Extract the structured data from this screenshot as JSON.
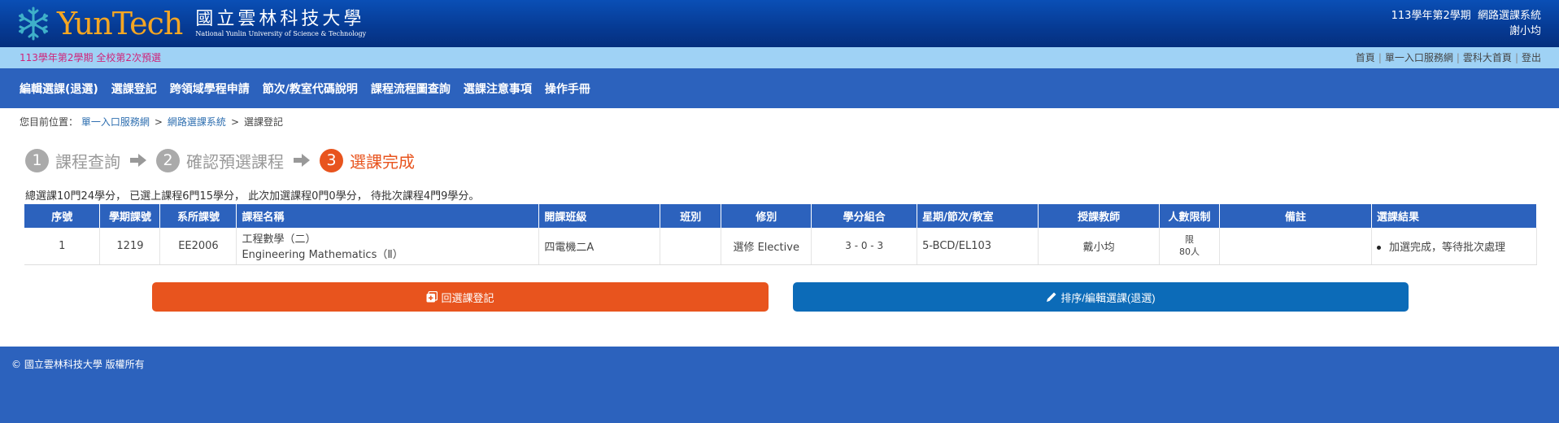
{
  "header": {
    "logo_en_1": "Yun",
    "logo_en_2": "Tech",
    "logo_cn": "國立雲林科技大學",
    "logo_en_sub": "National Yunlin University of Science & Technology",
    "system": "113學年第2學期  網路選課系統",
    "user": "謝小均",
    "brand_color": "#063a93",
    "logo_color": "#f5a623"
  },
  "subbar": {
    "term": "113學年第2學期 全校第2次預選",
    "links": [
      "首頁",
      "單一入口服務網",
      "雲科大首頁",
      "登出"
    ],
    "separator": "|"
  },
  "nav": {
    "items": [
      "編輯選課(退選)",
      "選課登記",
      "跨領域學程申請",
      "節次/教室代碼說明",
      "課程流程圖查詢",
      "選課注意事項",
      "操作手冊"
    ]
  },
  "breadcrumb": {
    "prefix": "您目前位置：",
    "items": [
      "單一入口服務網",
      "網路選課系統",
      "選課登記"
    ],
    "separator": ">"
  },
  "steps": [
    {
      "num": "1",
      "label": "課程查詢"
    },
    {
      "num": "2",
      "label": "確認預選課程"
    },
    {
      "num": "3",
      "label": "選課完成"
    }
  ],
  "summary": "總選課10門24學分， 已選上課程6門15學分， 此次加選課程0門0學分， 待批次課程4門9學分。",
  "table": {
    "headers": [
      "序號",
      "學期課號",
      "系所課號",
      "課程名稱",
      "開課班級",
      "班別",
      "修別",
      "學分組合",
      "星期/節次/教室",
      "授課教師",
      "人數限制",
      "備註",
      "選課結果"
    ],
    "rows": [
      {
        "seq": "1",
        "term_code": "1219",
        "dept_code": "EE2006",
        "name_cn": "工程數學（二）",
        "name_en": "Engineering Mathematics（Ⅱ）",
        "class": "四電機二A",
        "section": "",
        "type": "選修 Elective",
        "credits": "3 - 0 - 3",
        "schedule": "5-BCD/EL103",
        "teacher": "戴小均",
        "limit_1": "限",
        "limit_2": "80人",
        "note": "",
        "result": "加選完成，等待批次處理"
      }
    ]
  },
  "buttons": {
    "back": "回選課登記",
    "edit": "排序/編輯選課(退選)",
    "back_color": "#e8541e",
    "edit_color": "#0c6bb8"
  },
  "footer": {
    "copyright": "© 國立雲林科技大學 版權所有"
  }
}
